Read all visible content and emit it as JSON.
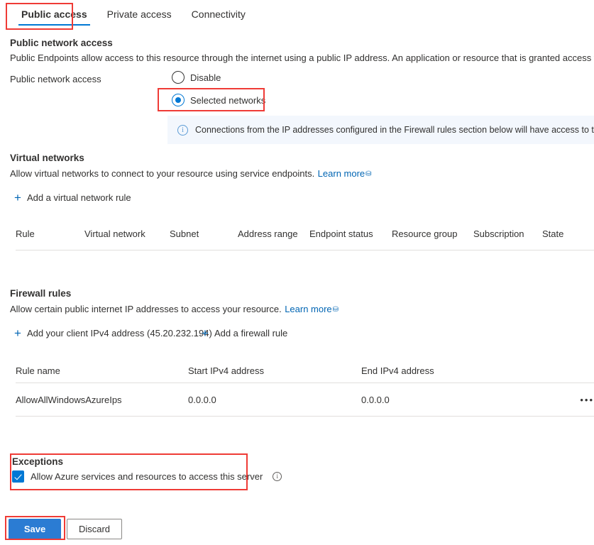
{
  "tabs": [
    {
      "label": "Public access",
      "active": true
    },
    {
      "label": "Private access",
      "active": false
    },
    {
      "label": "Connectivity",
      "active": false
    }
  ],
  "public_network_access": {
    "heading": "Public network access",
    "description": "Public Endpoints allow access to this resource through the internet using a public IP address. An application or resource that is granted access with the following",
    "field_label": "Public network access",
    "options": [
      {
        "label": "Disable",
        "selected": false
      },
      {
        "label": "Selected networks",
        "selected": true
      }
    ],
    "info_icon": "info-circle-icon",
    "info_banner": "Connections from the IP addresses configured in the Firewall rules section below will have access to this database. By d"
  },
  "virtual_networks": {
    "heading": "Virtual networks",
    "description": "Allow virtual networks to connect to your resource using service endpoints.",
    "learn_more": "Learn more",
    "external_glyph": "↗",
    "add_rule_label": "Add a virtual network rule",
    "plus_icon": "plus-icon",
    "columns": [
      "Rule",
      "Virtual network",
      "Subnet",
      "Address range",
      "Endpoint status",
      "Resource group",
      "Subscription",
      "State"
    ],
    "rows": []
  },
  "firewall_rules": {
    "heading": "Firewall rules",
    "description": "Allow certain public internet IP addresses to access your resource.",
    "learn_more": "Learn more",
    "external_glyph": "↗",
    "add_client_ip_label": "Add your client IPv4 address (45.20.232.194)",
    "add_firewall_rule_label": "Add a firewall rule",
    "plus_icon": "plus-icon",
    "columns": [
      "Rule name",
      "Start IPv4 address",
      "End IPv4 address"
    ],
    "rows": [
      {
        "rule_name": "AllowAllWindowsAzureIps",
        "start_ip": "0.0.0.0",
        "end_ip": "0.0.0.0",
        "menu": "•••"
      }
    ]
  },
  "exceptions": {
    "heading": "Exceptions",
    "checkbox_label": "Allow Azure services and resources to access this server",
    "checked": true,
    "info_icon": "info-circle-icon"
  },
  "footer": {
    "save_label": "Save",
    "discard_label": "Discard"
  },
  "colors": {
    "accent": "#0078d4",
    "primary_button": "#2b7cd3",
    "link": "#0065b3",
    "annotation": "#ef3b36",
    "info_banner_bg": "#f3f7fd"
  }
}
